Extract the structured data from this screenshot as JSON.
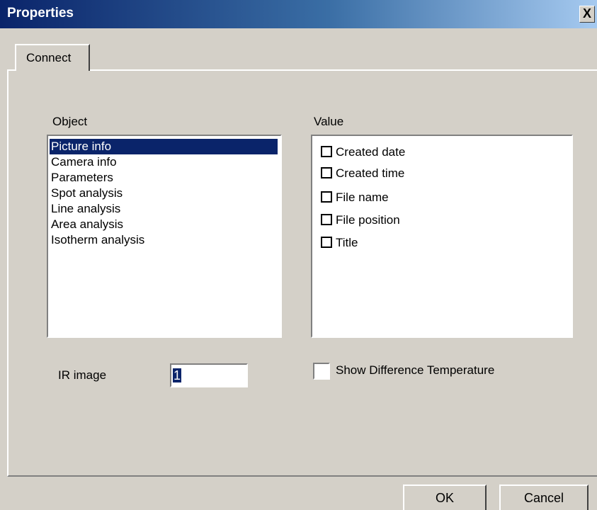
{
  "window": {
    "title": "Properties",
    "close_glyph": "X"
  },
  "tabs": [
    {
      "label": "Connect"
    }
  ],
  "object_list": {
    "label": "Object",
    "items": [
      "Picture info",
      "Camera info",
      "Parameters",
      "Spot analysis",
      "Line analysis",
      "Area analysis",
      "Isotherm analysis"
    ],
    "selected": "Picture info"
  },
  "value_list": {
    "label": "Value",
    "items": [
      {
        "label": "Created date",
        "checked": false
      },
      {
        "label": "Created time",
        "checked": false
      },
      {
        "label": "File name",
        "checked": false
      },
      {
        "label": "File position",
        "checked": false
      },
      {
        "label": "Title",
        "checked": false
      }
    ]
  },
  "ir_image": {
    "label": "IR image",
    "value": "1"
  },
  "show_difference": {
    "label": "Show Difference Temperature",
    "checked": false
  },
  "buttons": {
    "ok": "OK",
    "cancel": "Cancel"
  }
}
